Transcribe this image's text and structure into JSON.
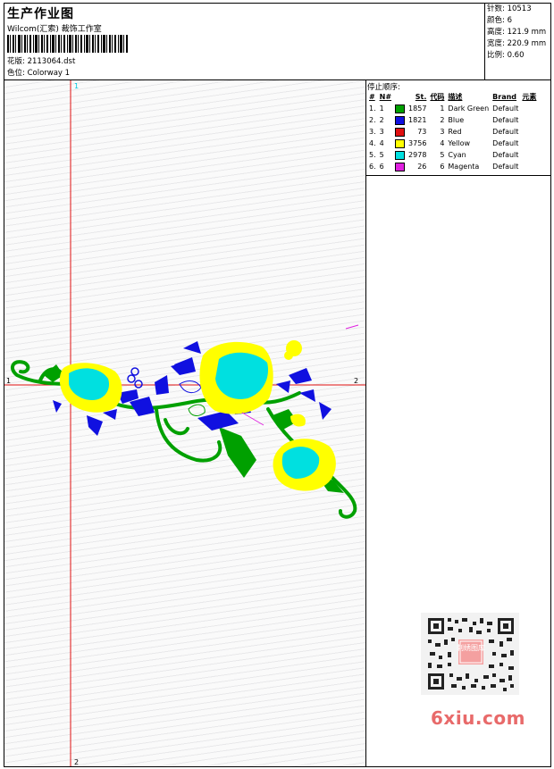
{
  "header": {
    "title": "生产作业图",
    "company": "Wilcom(汇索) 裁饰工作室",
    "design_label": "花版:",
    "design_value": "2113064.dst",
    "colorway_label": "色位:",
    "colorway_value": "Colorway 1"
  },
  "stats": {
    "stitches": "针数: 10513",
    "colors": "颜色: 6",
    "height": "高度: 121.9 mm",
    "width": "宽度: 220.9 mm",
    "scale": "比例: 0.60"
  },
  "stop_sequence": {
    "title": "停止顺序:",
    "columns": [
      "#",
      "N#",
      "St.",
      "代码",
      "描述",
      "Brand",
      "元素"
    ],
    "rows": [
      {
        "idx": "1.",
        "n": "1",
        "color": "#00a000",
        "st": "1857",
        "code": "1",
        "desc": "Dark Green",
        "brand": "Default"
      },
      {
        "idx": "2.",
        "n": "2",
        "color": "#1010e0",
        "st": "1821",
        "code": "2",
        "desc": "Blue",
        "brand": "Default"
      },
      {
        "idx": "3.",
        "n": "3",
        "color": "#e01010",
        "st": "73",
        "code": "3",
        "desc": "Red",
        "brand": "Default"
      },
      {
        "idx": "4.",
        "n": "4",
        "color": "#ffff00",
        "st": "3756",
        "code": "4",
        "desc": "Yellow",
        "brand": "Default"
      },
      {
        "idx": "5.",
        "n": "5",
        "color": "#00e0e0",
        "st": "2978",
        "code": "5",
        "desc": "Cyan",
        "brand": "Default"
      },
      {
        "idx": "6.",
        "n": "6",
        "color": "#e020e0",
        "st": "26",
        "code": "6",
        "desc": "Magenta",
        "brand": "Default"
      }
    ]
  },
  "axes": {
    "top_label": "1",
    "bottom_label": "2",
    "left_label": "1",
    "right_label": "2"
  },
  "watermark": {
    "qr_center_text": "刺绣图库",
    "site": "6xiu.com"
  },
  "colors": {
    "axis_red": "#e01010",
    "dark_green": "#00a000",
    "blue": "#1010e0",
    "yellow": "#ffff00",
    "cyan": "#00e0e0",
    "magenta": "#e020e0",
    "brand_pink": "#e86a6a"
  }
}
